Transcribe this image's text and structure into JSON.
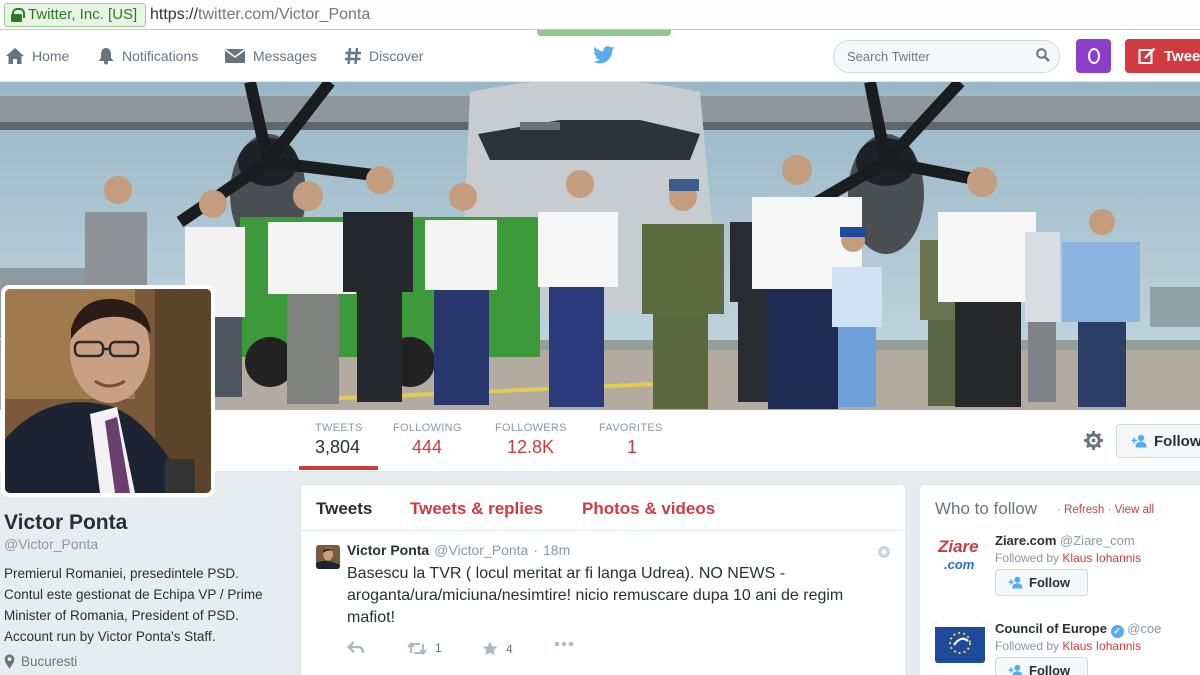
{
  "browser": {
    "site_identity": "Twitter, Inc. [US]",
    "url_scheme": "https://",
    "url_host": "twitter.com",
    "url_path": "/Victor_Ponta"
  },
  "nav": {
    "home": "Home",
    "notifications": "Notifications",
    "messages": "Messages",
    "discover": "Discover",
    "search_placeholder": "Search Twitter",
    "tweet_button": "Tweet"
  },
  "profile": {
    "name": "Victor Ponta",
    "handle": "@Victor_Ponta",
    "bio": "Premierul Romaniei, presedintele PSD. Contul este gestionat de Echipa VP / Prime Minister of Romania, President of PSD. Account run by Victor Ponta's Staff.",
    "location": "Bucuresti",
    "follow_button": "Follow"
  },
  "stats": [
    {
      "label": "Tweets",
      "value": "3,804"
    },
    {
      "label": "Following",
      "value": "444"
    },
    {
      "label": "Followers",
      "value": "12.8K"
    },
    {
      "label": "Favorites",
      "value": "1"
    }
  ],
  "timeline": {
    "tabs": [
      "Tweets",
      "Tweets & replies",
      "Photos & videos"
    ],
    "tweet": {
      "name": "Victor Ponta",
      "handle": "@Victor_Ponta",
      "separator": "·",
      "time": "18m",
      "text": "Basescu la TVR ( locul meritat ar fi langa Udrea). NO NEWS - aroganta/ura/miciuna/nesimtire! nicio remuscare dupa 10 ani de regim mafiot!",
      "retweets": "1",
      "favorites": "4"
    }
  },
  "who_to_follow": {
    "title": "Who to follow",
    "separator": "·",
    "refresh": "Refresh",
    "view_all": "View all",
    "suggestions": [
      {
        "name": "Ziare.com",
        "handle": "@Ziare_com",
        "followed_by_prefix": "Followed by",
        "followed_by": "Klaus Iohannis",
        "follow": "Follow",
        "logo_text_1": "Ziare",
        "logo_text_2": ".com"
      },
      {
        "name": "Council of Europe",
        "handle": "@coe",
        "followed_by_prefix": "Followed by",
        "followed_by": "Klaus Iohannis",
        "follow": "Follow"
      }
    ],
    "dismiss": "×"
  },
  "colors": {
    "accent": "#d13b3f",
    "twitter_blue": "#55acee",
    "background": "#e7ecf0"
  }
}
